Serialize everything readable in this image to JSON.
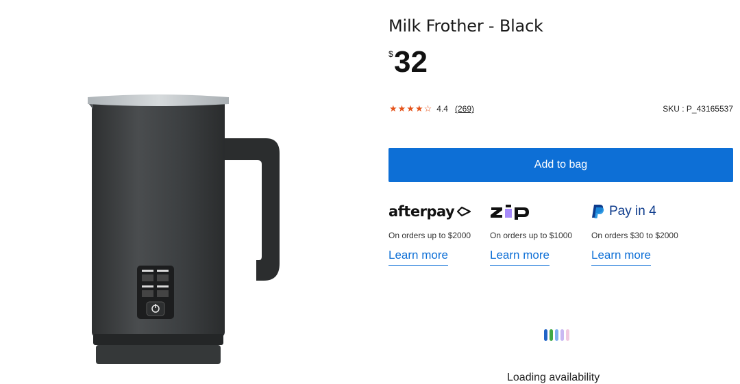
{
  "product": {
    "title": "Milk Frother - Black",
    "currency_symbol": "$",
    "price": "32",
    "rating_stars": "★★★★☆",
    "rating_value": "4.4",
    "review_count": "(269)",
    "sku": "SKU : P_43165537",
    "image_icon": "milk-frother-image"
  },
  "actions": {
    "add_to_bag_label": "Add to bag"
  },
  "payment_options": [
    {
      "name": "afterpay",
      "logo_text": "afterpay",
      "description": "On orders up to $2000",
      "link": "Learn more"
    },
    {
      "name": "zip",
      "logo_text": "zip",
      "description": "On orders up to $1000",
      "link": "Learn more"
    },
    {
      "name": "paypal",
      "logo_text": "Pay in 4",
      "description": "On orders $30 to $2000",
      "link": "Learn more"
    }
  ],
  "availability": {
    "loading_text": "Loading availability"
  },
  "colors": {
    "accent": "#0d6fd6",
    "star": "#e5531a",
    "zip_purple": "#a78bfa",
    "loader": [
      "#1f63c6",
      "#3fa845",
      "#7fb0f0",
      "#c9b8f2",
      "#f1c9df"
    ]
  }
}
